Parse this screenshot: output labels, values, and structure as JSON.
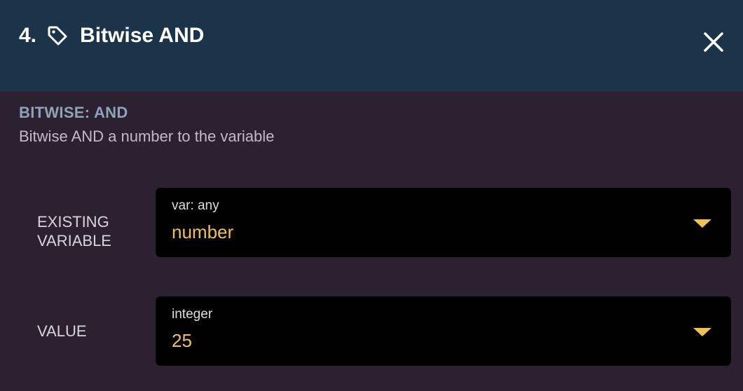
{
  "header": {
    "number": "4.",
    "title": "Bitwise AND",
    "tag_icon": "tag-icon",
    "close_icon": "close-icon"
  },
  "section": {
    "title": "BITWISE: AND",
    "description": "Bitwise AND a number to the variable"
  },
  "fields": [
    {
      "label_line1": "EXISTING",
      "label_line2": "VARIABLE",
      "type": "var: any",
      "value": "number",
      "caret_icon": "caret-down-icon"
    },
    {
      "label_line1": "VALUE",
      "type": "integer",
      "value": "25",
      "caret_icon": "caret-down-icon"
    }
  ],
  "colors": {
    "header_bg": "#1c344a",
    "body_bg": "#2b2131",
    "accent": "#f2c14e",
    "section_title": "#8fa3b8"
  }
}
